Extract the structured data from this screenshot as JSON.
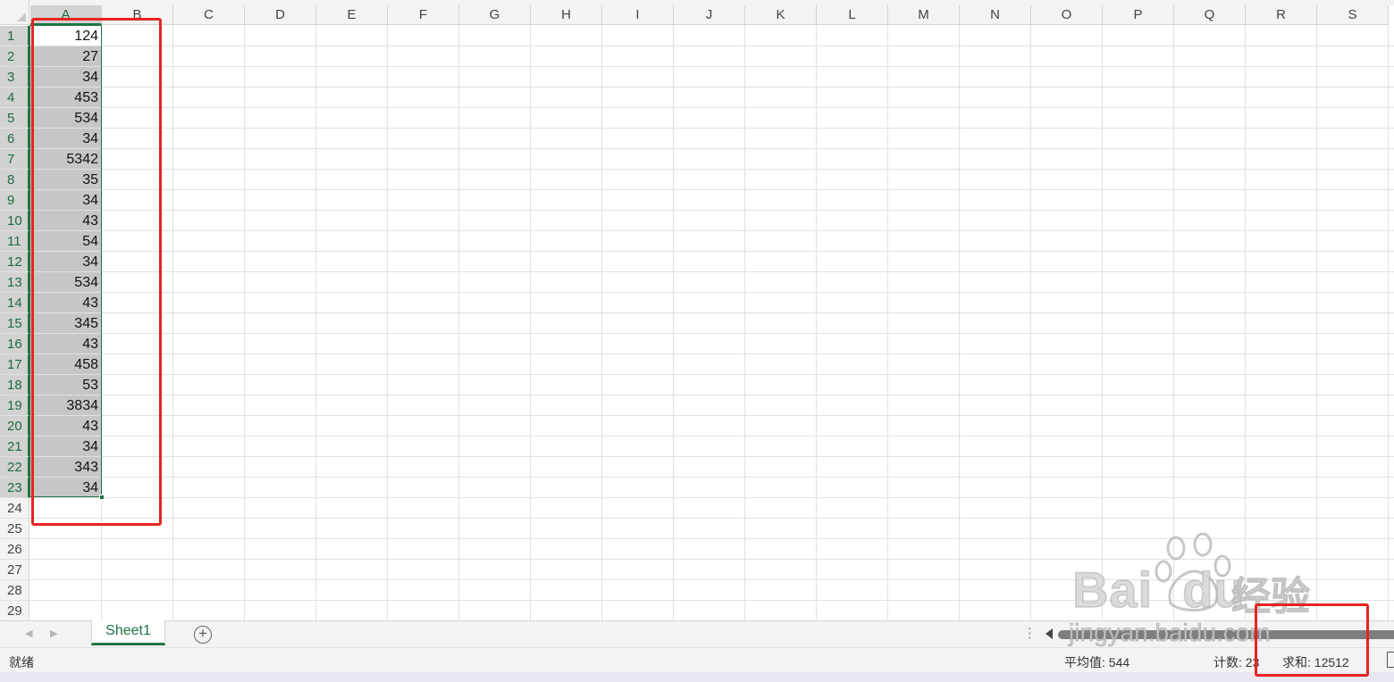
{
  "columns": [
    "A",
    "B",
    "C",
    "D",
    "E",
    "F",
    "G",
    "H",
    "I",
    "J",
    "K",
    "L",
    "M",
    "N",
    "O",
    "P",
    "Q",
    "R",
    "S"
  ],
  "rows": [
    "1",
    "2",
    "3",
    "4",
    "5",
    "6",
    "7",
    "8",
    "9",
    "10",
    "11",
    "12",
    "13",
    "14",
    "15",
    "16",
    "17",
    "18",
    "19",
    "20",
    "21",
    "22",
    "23",
    "24",
    "25",
    "26",
    "27",
    "28",
    "29"
  ],
  "column_a_values": [
    "124",
    "27",
    "34",
    "453",
    "534",
    "34",
    "5342",
    "35",
    "34",
    "43",
    "54",
    "34",
    "534",
    "43",
    "345",
    "43",
    "458",
    "53",
    "3834",
    "43",
    "34",
    "343",
    "34"
  ],
  "sheet_tabs": [
    {
      "label": "Sheet1"
    }
  ],
  "tab_bar": {
    "add_label": "+",
    "dots_label": "⋮",
    "prev_label": "◀",
    "next_label": "▶"
  },
  "status": {
    "ready": "就绪",
    "average": "平均值: 544",
    "count": "计数: 23",
    "sum": "求和: 12512"
  },
  "watermark": {
    "brand": "Bai",
    "brand2": "du",
    "cn": "经验",
    "url": "jingyan.baidu.com"
  },
  "colors": {
    "accent": "#217346",
    "annotation": "#e8241f",
    "selection": "#c6c6c6"
  }
}
